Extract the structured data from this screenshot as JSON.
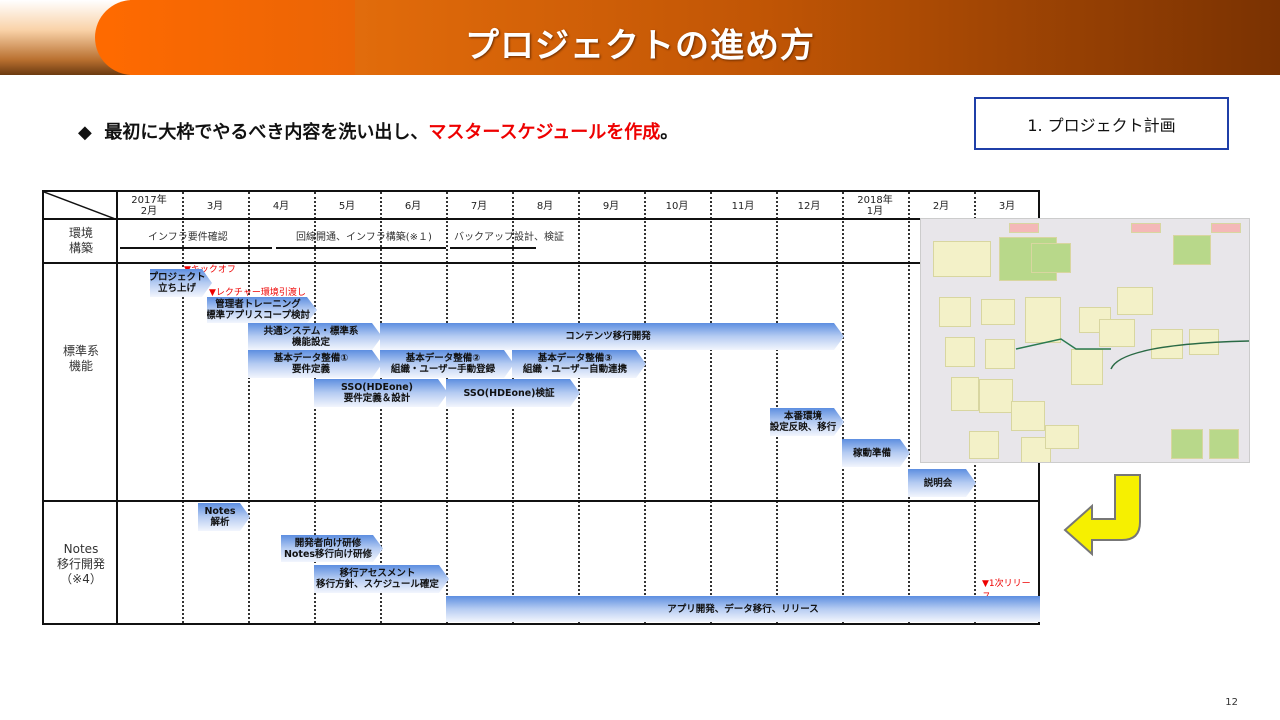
{
  "header": {
    "title": "プロジェクトの進め方"
  },
  "bullet": {
    "marker": "◆",
    "text": "最初に大枠でやるべき内容を洗い出し、",
    "highlight": "マスタースケジュールを作成",
    "end": "。"
  },
  "section_box": "1. プロジェクト計画",
  "schedule": {
    "months": [
      "2017年\n2月",
      "3月",
      "4月",
      "5月",
      "6月",
      "7月",
      "8月",
      "9月",
      "10月",
      "11月",
      "12月",
      "2018年\n1月",
      "2月",
      "3月"
    ],
    "rows": [
      "環境\n構築",
      "標準系\n機能",
      "Notes\n移行開発\n（※4）"
    ],
    "env": [
      "インフラ要件確認",
      "回線開通、インフラ構築(※１)",
      "バックアップ設計、検証"
    ],
    "markers": {
      "kickoff": "▼キックオフ",
      "lecture": "▼レクチャー環境引渡し",
      "release": "▼1次リリース"
    },
    "bars": {
      "launch": "プロジェクト\n立ち上げ",
      "admin": "管理者トレーニング\n標準アプリスコープ検討",
      "common": "共通システム・標準系\n機能設定",
      "content": "コンテンツ移行開発",
      "data1": "基本データ整備①\n要件定義",
      "data2": "基本データ整備②\n組織・ユーザー手動登録",
      "data3": "基本データ整備③\n組織・ユーザー自動連携",
      "sso1": "SSO(HDEone)\n要件定義＆設計",
      "sso2": "SSO(HDEone)検証",
      "prod": "本番環境\n設定反映、移行",
      "prep": "稼動準備",
      "brief": "説明会",
      "notes": "Notes\n解析",
      "training": "開発者向け研修\nNotes移行向け研修",
      "assess": "移行アセスメント\n移行方針、スケジュール確定",
      "app": "アプリ開発、データ移行、リリース"
    }
  },
  "page_number": "12"
}
